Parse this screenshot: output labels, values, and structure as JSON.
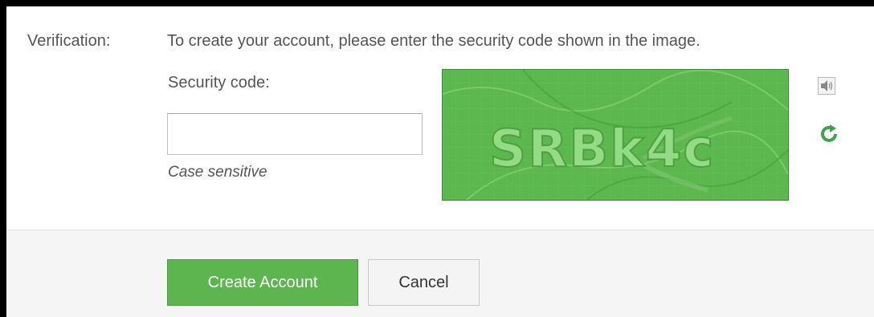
{
  "verification": {
    "label": "Verification:",
    "instructions": "To create your account, please enter the security code shown in the image.",
    "security_code_label": "Security code:",
    "security_code_value": "",
    "case_hint": "Case sensitive",
    "captcha_text": "SRBk4c",
    "audio_icon": "speaker-icon",
    "refresh_icon": "refresh-icon"
  },
  "actions": {
    "create_label": "Create Account",
    "cancel_label": "Cancel"
  },
  "colors": {
    "accent_green": "#5cb54f",
    "captcha_green": "#5cb84e",
    "refresh_green": "#3fa34d"
  }
}
